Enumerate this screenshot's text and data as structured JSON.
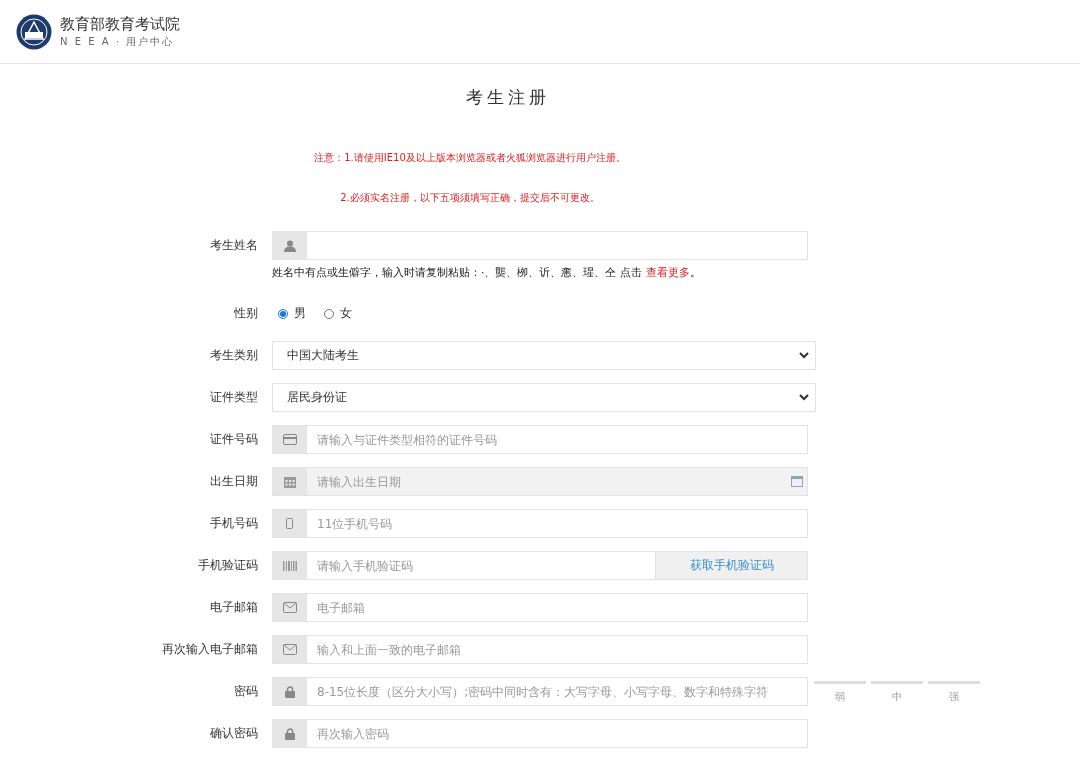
{
  "header": {
    "org_name": "教育部教育考试院",
    "subtitle": "N E E A · 用户中心"
  },
  "title": "考生注册",
  "notices": [
    "注意：1.请使用IE10及以上版本浏览器或者火狐浏览器进行用户注册。",
    "2.必须实名注册，以下五项须填写正确，提交后不可更改。"
  ],
  "fields": [
    {
      "kind": "person",
      "label": "考生姓名",
      "readonly": false,
      "hint": {
        "text": "姓名中有点或生僻字，输入时请复制粘贴：·、龑、栁、䜣、㥣、瑆、仝 点击 ",
        "link": "查看更多",
        "end": "。"
      }
    },
    {
      "kind": "radio",
      "label": "性别",
      "options": [
        {
          "label": "男",
          "selected": true
        },
        {
          "label": "女",
          "selected": false
        }
      ]
    },
    {
      "kind": "select",
      "label": "考生类别",
      "value": "中国大陆考生"
    },
    {
      "kind": "select",
      "label": "证件类型",
      "value": "居民身份证"
    },
    {
      "kind": "card",
      "label": "证件号码",
      "placeholder": "请输入与证件类型相符的证件号码",
      "readonly": false
    },
    {
      "kind": "date",
      "label": "出生日期",
      "placeholder": "请输入出生日期",
      "readonly": true
    },
    {
      "kind": "phone",
      "label": "手机号码",
      "placeholder": "11位手机号码",
      "readonly": false
    },
    {
      "kind": "barcode",
      "label": "手机验证码",
      "placeholder": "请输入手机验证码",
      "readonly": false,
      "button": "获取手机验证码"
    },
    {
      "kind": "mail",
      "label": "电子邮箱",
      "placeholder": "电子邮箱",
      "readonly": false
    },
    {
      "kind": "mail",
      "label": "再次输入电子邮箱",
      "placeholder": "输入和上面一致的电子邮箱",
      "readonly": false
    },
    {
      "kind": "lock",
      "label": "密码",
      "placeholder": "8-15位长度（区分大小写）;密码中同时含有：大写字母、小写字母、数字和特殊字符",
      "readonly": false,
      "strength": [
        "弱",
        "中",
        "强"
      ]
    },
    {
      "kind": "lock",
      "label": "确认密码",
      "placeholder": "再次输入密码",
      "readonly": false
    }
  ]
}
